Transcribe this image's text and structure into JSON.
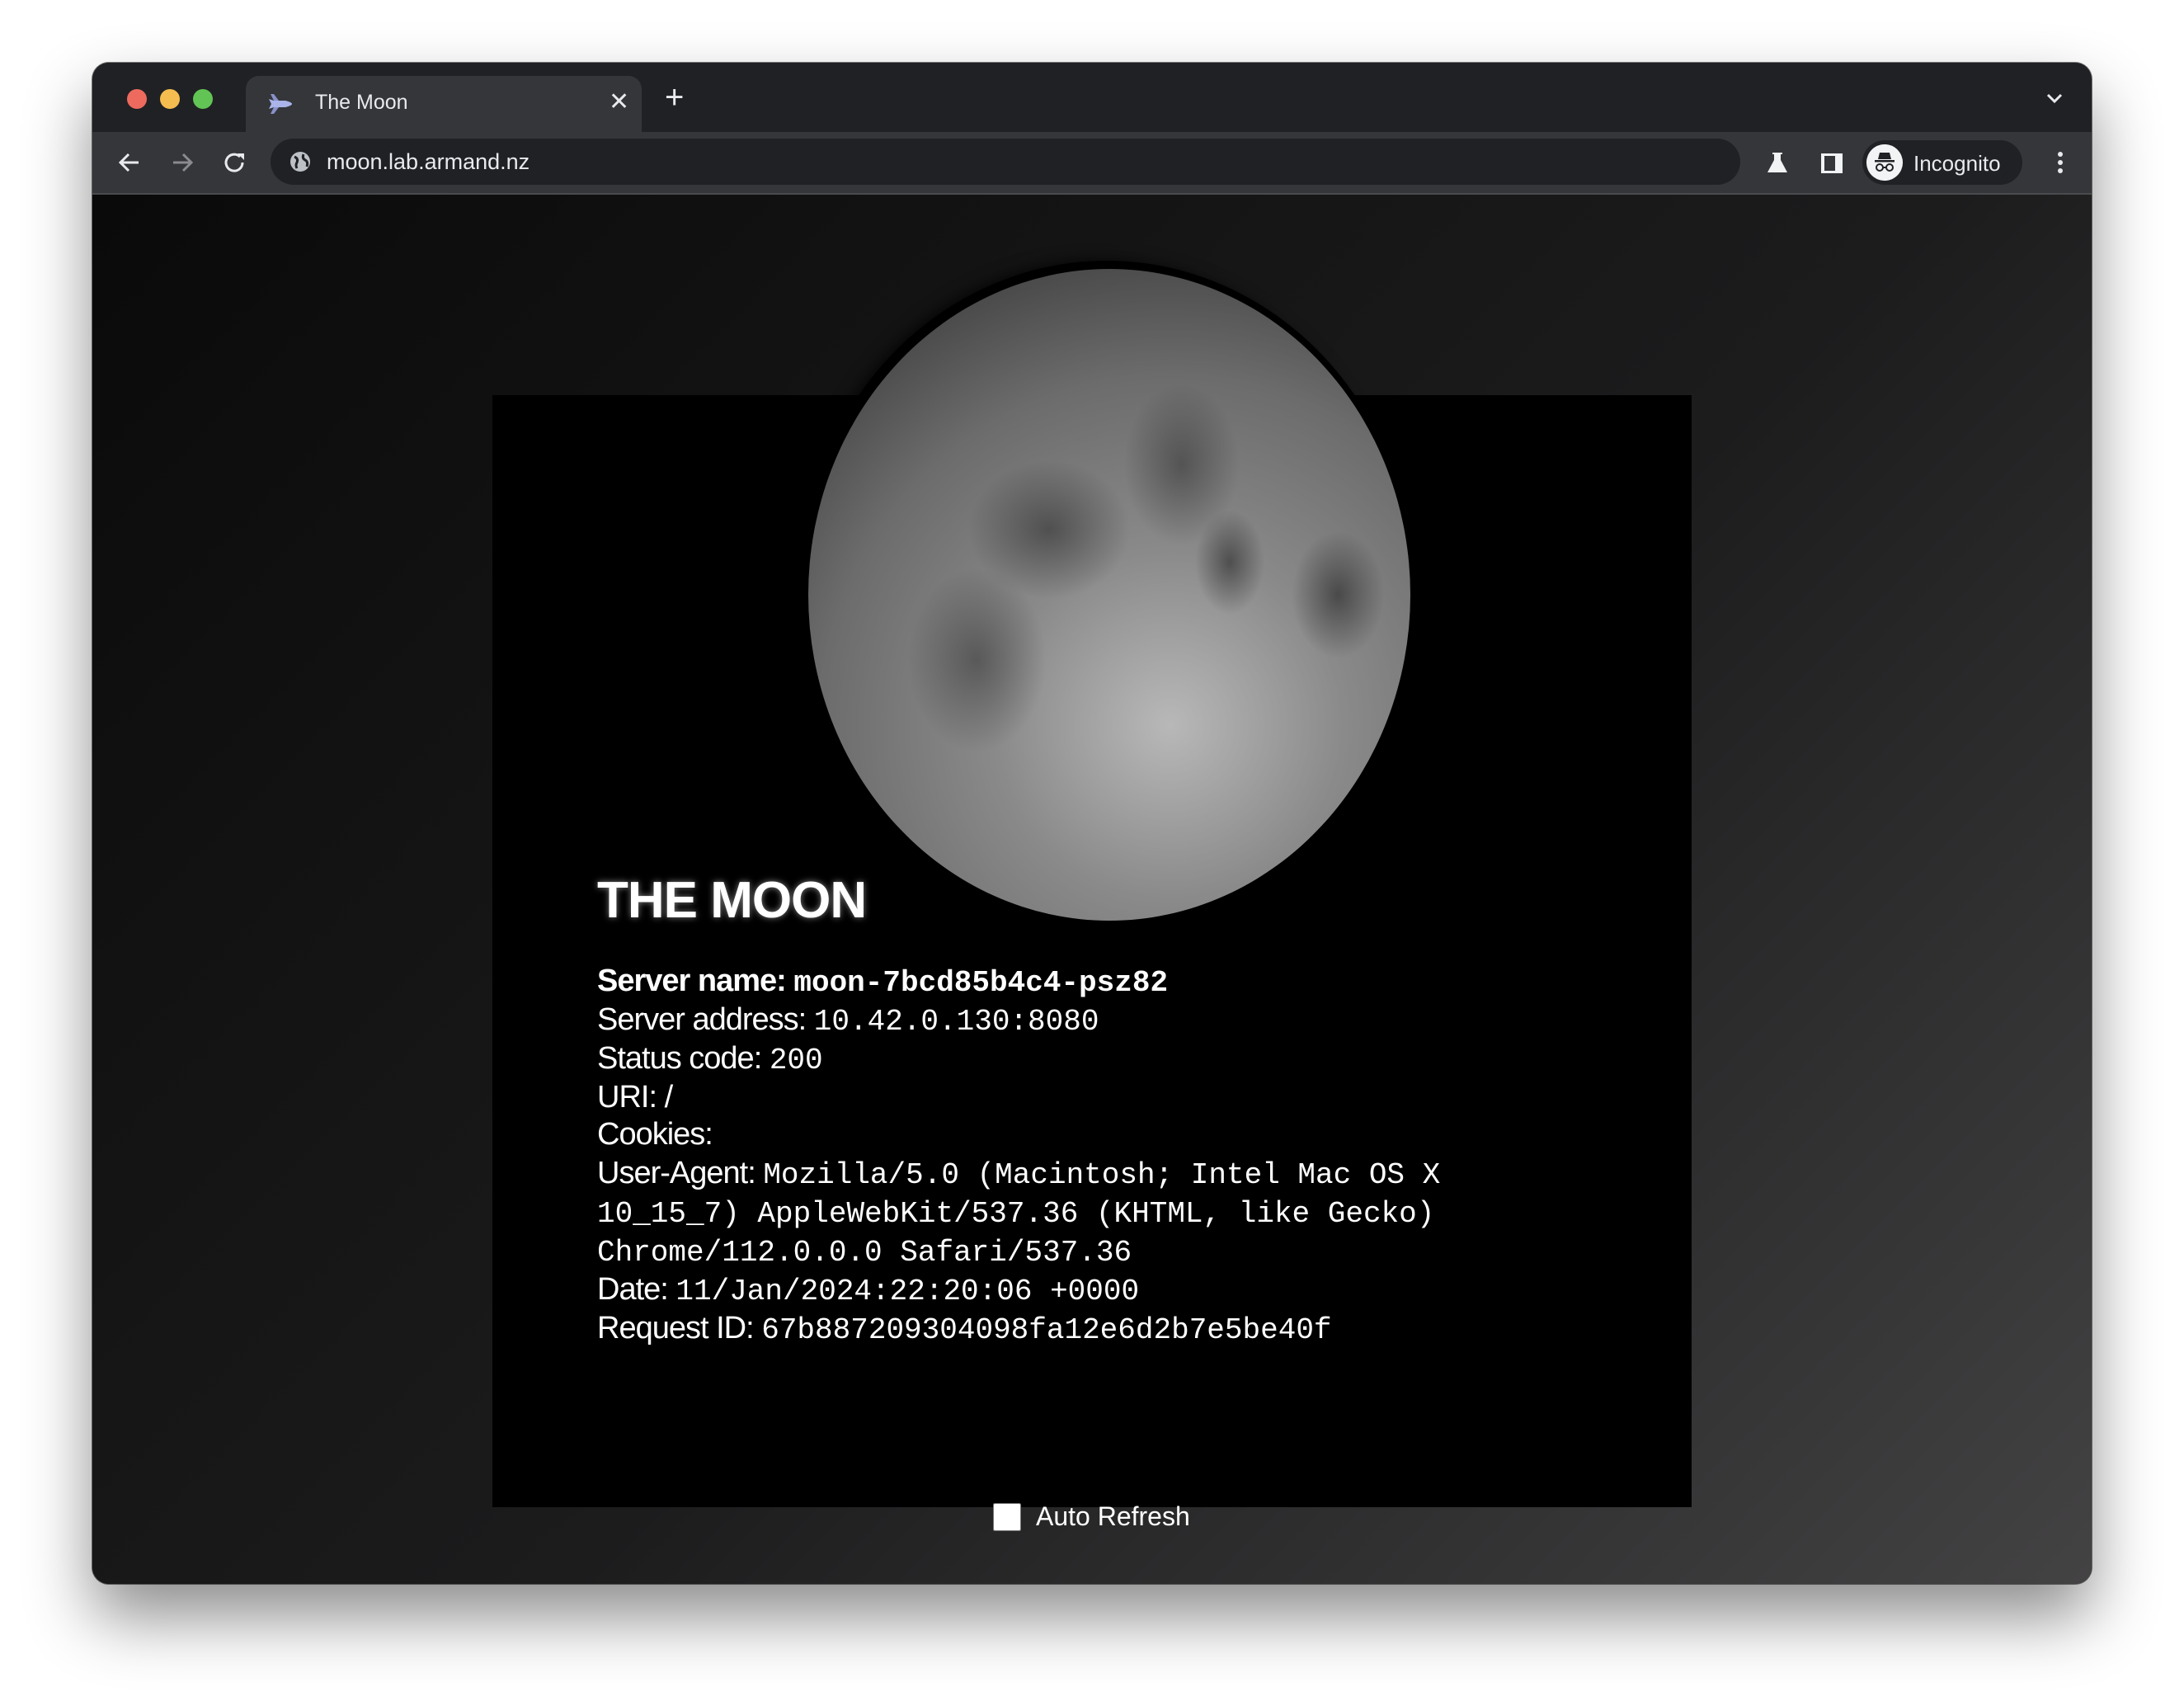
{
  "browser": {
    "tab": {
      "title": "The Moon",
      "icon": "space-shuttle-icon",
      "close_icon": "close-icon"
    },
    "new_tab_icon": "plus-icon",
    "tab_search_icon": "chevron-down-icon",
    "nav": {
      "back_icon": "arrow-left-icon",
      "forward_icon": "arrow-right-icon",
      "reload_icon": "reload-icon"
    },
    "omnibox": {
      "site_icon": "globe-icon",
      "url": "moon.lab.armand.nz"
    },
    "toolbar": {
      "labs_icon": "flask-icon",
      "side_panel_icon": "side-panel-icon",
      "profile_label": "Incognito",
      "menu_icon": "kebab-menu-icon"
    },
    "colors": {
      "close": "#ee6a5f",
      "minimize": "#f5bd4f",
      "maximize": "#61c454"
    }
  },
  "page": {
    "title": "THE MOON",
    "fields": [
      {
        "label": "Server name:",
        "value": "moon-7bcd85b4c4-psz82"
      },
      {
        "label": "Server address:",
        "value": "10.42.0.130:8080"
      },
      {
        "label": "Status code:",
        "value": "200"
      },
      {
        "label": "URI:",
        "value": "/"
      },
      {
        "label": "Cookies:",
        "value": ""
      },
      {
        "label": "User-Agent:",
        "value": "Mozilla/5.0 (Macintosh; Intel Mac OS X 10_15_7) AppleWebKit/537.36 (KHTML, like Gecko) Chrome/112.0.0.0 Safari/537.36"
      },
      {
        "label": "Date:",
        "value": "11/Jan/2024:22:20:06 +0000"
      },
      {
        "label": "Request ID:",
        "value": "67b887209304098fa12e6d2b7e5be40f"
      }
    ],
    "auto_refresh": {
      "label": "Auto Refresh",
      "checked": false
    }
  }
}
